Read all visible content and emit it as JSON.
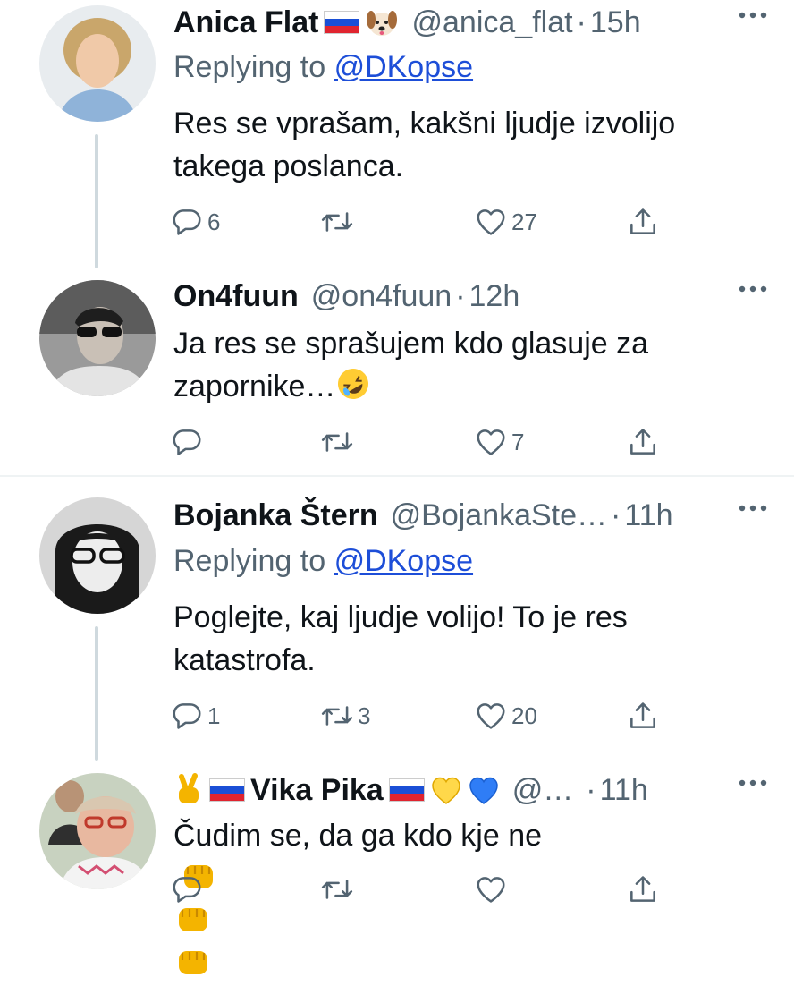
{
  "tweets": [
    {
      "name": "Anica Flat",
      "handle": "@anica_flat",
      "dot": "·",
      "time": "15h",
      "replying_prefix": "Replying to",
      "replying_to": "@DKopse",
      "text": "Res se vprašam,  kakšni ljudje izvolijo\ntakega poslanca.",
      "replies": "6",
      "retweets": "",
      "likes": "27"
    },
    {
      "name": "On4fuun",
      "handle": "@on4fuun",
      "dot": "·",
      "time": "12h",
      "text": "Ja res se sprašujem kdo glasuje za\nzapornike…",
      "replies": "",
      "retweets": "",
      "likes": "7"
    },
    {
      "name": "Bojanka Štern",
      "handle": "@BojankaSte…",
      "dot": "·",
      "time": "11h",
      "replying_prefix": "Replying to",
      "replying_to": "@DKopse",
      "text": "Poglejte, kaj ljudje volijo! To je res\nkatastrofa.",
      "replies": "1",
      "retweets": "3",
      "likes": "20"
    },
    {
      "name": "Vika Pika",
      "handle": "@…",
      "dot": "·",
      "time": "11h",
      "text": "Čudim se, da ga kdo kje ne",
      "replies": "",
      "retweets": "",
      "likes": ""
    }
  ],
  "colors": {
    "secondary_text": "#536471",
    "link": "#1d4ed8",
    "divider": "#eff3f4",
    "thread_line": "#cfd9de"
  },
  "icons": [
    "reply-icon",
    "retweet-icon",
    "like-icon",
    "share-icon",
    "more-icon",
    "slovenia-flag-icon",
    "dog-face-icon",
    "rofl-emoji-icon",
    "victory-hand-icon",
    "yellow-heart-icon",
    "blue-heart-icon",
    "fist-bump-icon"
  ]
}
